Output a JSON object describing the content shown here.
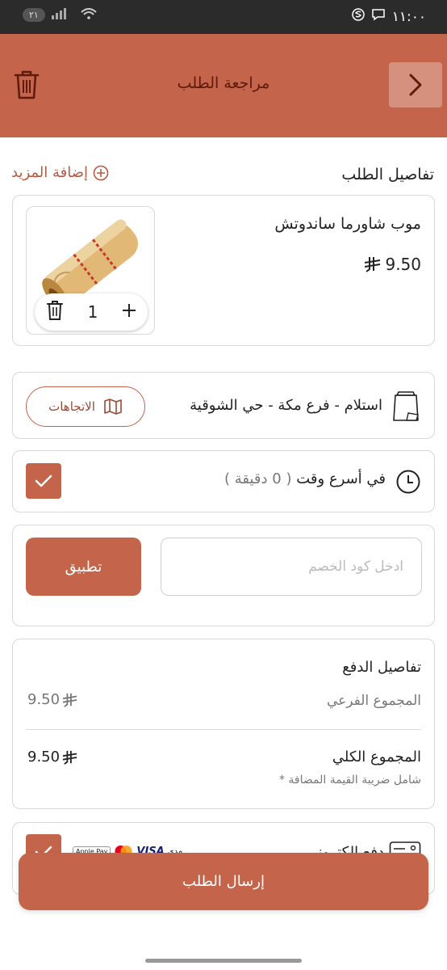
{
  "status_bar": {
    "time": "١١:٠٠",
    "battery": "٢١"
  },
  "header": {
    "title": "مراجعة الطلب"
  },
  "order": {
    "section_title": "تفاصيل الطلب",
    "add_more_label": "إضافة المزيد",
    "item": {
      "name": "موب شاورما ساندوتش",
      "price": "9.50",
      "quantity": "1"
    }
  },
  "pickup": {
    "label": "استلام - فرع مكة - حي الشوقية",
    "directions_label": "الاتجاهات"
  },
  "timing": {
    "label": "في أسرع وقت",
    "minutes": "( 0 دقيقة )"
  },
  "promo": {
    "placeholder": "ادخل كود الخصم",
    "apply_label": "تطبيق"
  },
  "payment": {
    "title": "تفاصيل الدفع",
    "subtotal_label": "المجموع الفرعي",
    "subtotal_value": "9.50",
    "total_label": "المجموع الكلي",
    "total_value": "9.50",
    "vat_note": "شامل ضريبة القيمة المضافة *"
  },
  "payment_method": {
    "label": "دفع الكتروني",
    "logos": [
      "مدى",
      "VISA",
      "mastercard",
      "Apple Pay"
    ]
  },
  "submit_label": "إرسال الطلب",
  "colors": {
    "accent": "#c4644a",
    "header_text": "#5e1a0d",
    "status_bar": "#2b2b2b"
  }
}
